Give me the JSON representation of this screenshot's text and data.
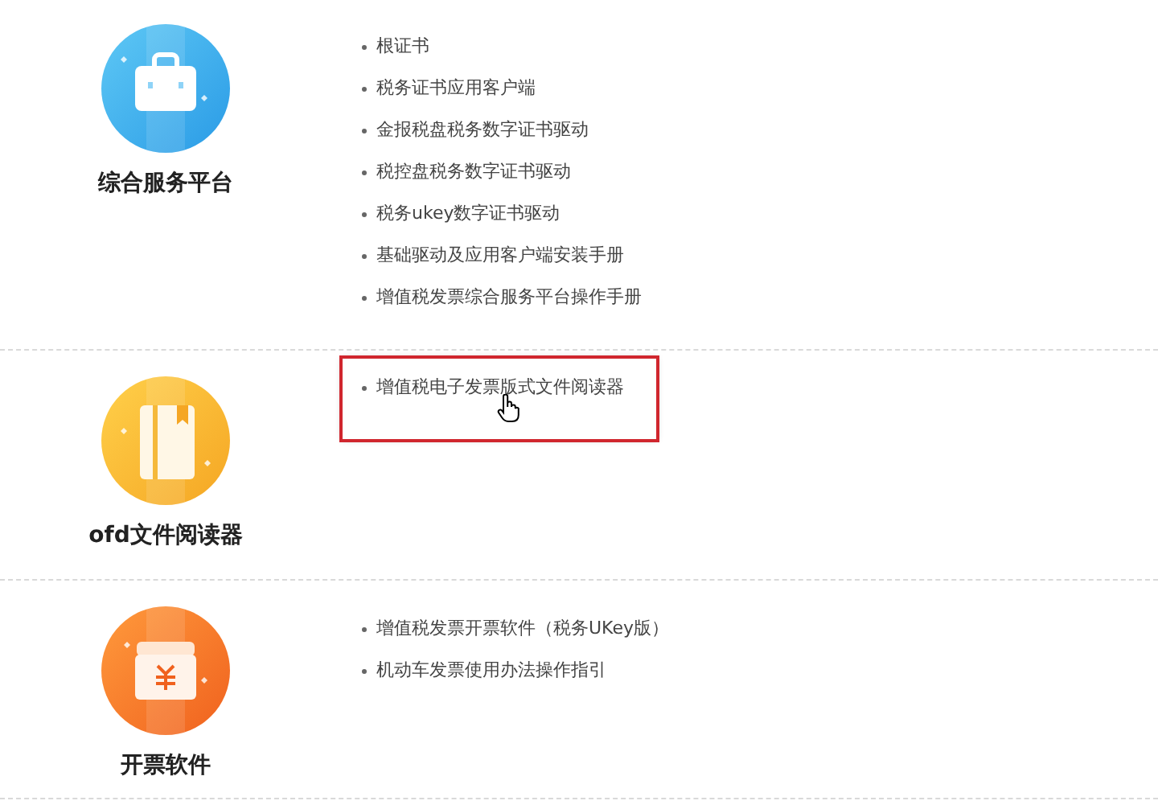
{
  "sections": [
    {
      "kind": "briefcase",
      "title": "综合服务平台",
      "links": [
        {
          "text": "根证书",
          "highlighted": false
        },
        {
          "text": "税务证书应用客户端",
          "highlighted": false
        },
        {
          "text": "金报税盘税务数字证书驱动",
          "highlighted": false
        },
        {
          "text": "税控盘税务数字证书驱动",
          "highlighted": false
        },
        {
          "text": "税务ukey数字证书驱动",
          "highlighted": false
        },
        {
          "text": "基础驱动及应用客户端安装手册",
          "highlighted": false
        },
        {
          "text": "增值税发票综合服务平台操作手册",
          "highlighted": false
        }
      ]
    },
    {
      "kind": "book",
      "title": "ofd文件阅读器",
      "links": [
        {
          "text": "增值税电子发票版式文件阅读器",
          "highlighted": true
        }
      ]
    },
    {
      "kind": "money",
      "title": "开票软件",
      "links": [
        {
          "text": "增值税发票开票软件（税务UKey版）",
          "highlighted": false
        },
        {
          "text": "机动车发票使用办法操作指引",
          "highlighted": false
        }
      ]
    }
  ]
}
